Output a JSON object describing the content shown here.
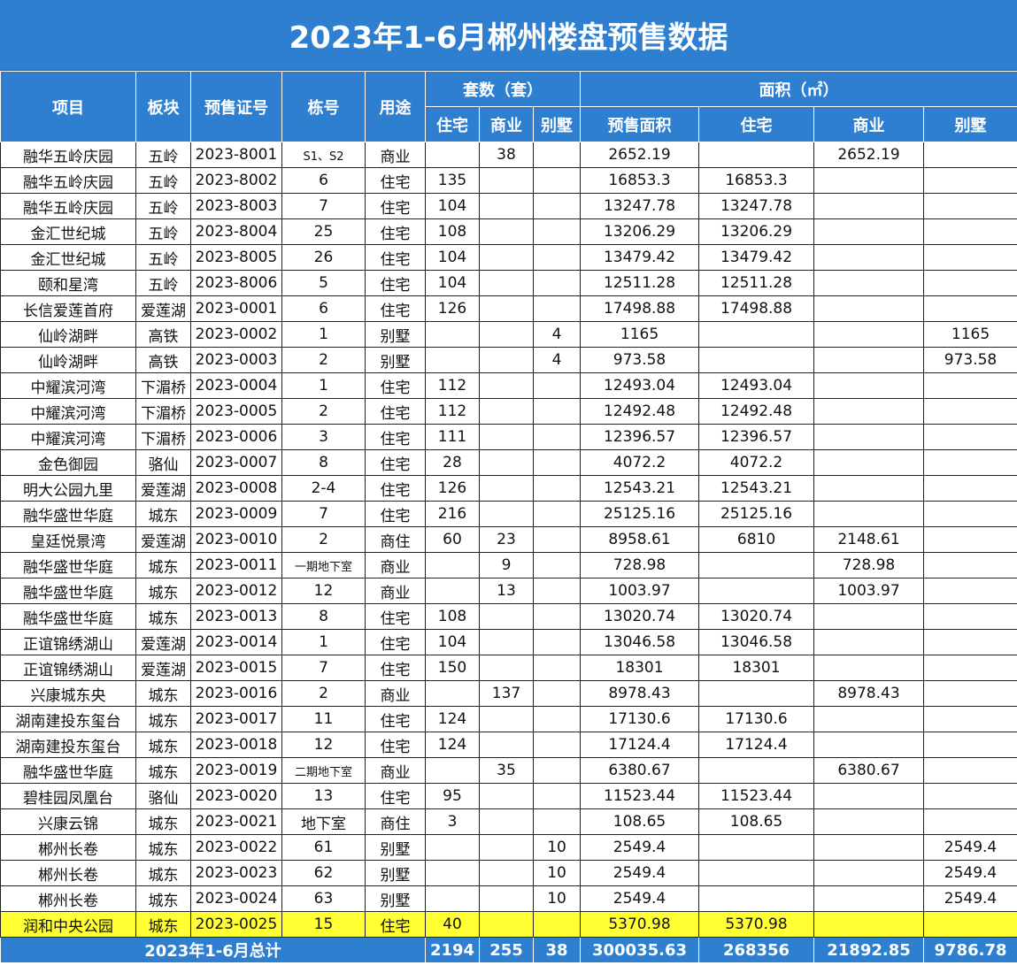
{
  "title": "2023年1-6月郴州楼盘预售数据",
  "headers": {
    "project": "项目",
    "block": "板块",
    "permit": "预售证号",
    "building": "栋号",
    "usage": "用途",
    "units_group": "套数（套）",
    "area_group": "面积（㎡）",
    "units_res": "住宅",
    "units_com": "商业",
    "units_villa": "别墅",
    "area_presale": "预售面积",
    "area_res": "住宅",
    "area_com": "商业",
    "area_villa": "别墅"
  },
  "rows": [
    {
      "project": "融华五岭庆园",
      "block": "五岭",
      "permit": "2023-8001",
      "building": "S1、S2",
      "usage": "商业",
      "u_res": "",
      "u_com": "38",
      "u_villa": "",
      "a_total": "2652.19",
      "a_res": "",
      "a_com": "2652.19",
      "a_villa": ""
    },
    {
      "project": "融华五岭庆园",
      "block": "五岭",
      "permit": "2023-8002",
      "building": "6",
      "usage": "住宅",
      "u_res": "135",
      "u_com": "",
      "u_villa": "",
      "a_total": "16853.3",
      "a_res": "16853.3",
      "a_com": "",
      "a_villa": ""
    },
    {
      "project": "融华五岭庆园",
      "block": "五岭",
      "permit": "2023-8003",
      "building": "7",
      "usage": "住宅",
      "u_res": "104",
      "u_com": "",
      "u_villa": "",
      "a_total": "13247.78",
      "a_res": "13247.78",
      "a_com": "",
      "a_villa": ""
    },
    {
      "project": "金汇世纪城",
      "block": "五岭",
      "permit": "2023-8004",
      "building": "25",
      "usage": "住宅",
      "u_res": "108",
      "u_com": "",
      "u_villa": "",
      "a_total": "13206.29",
      "a_res": "13206.29",
      "a_com": "",
      "a_villa": ""
    },
    {
      "project": "金汇世纪城",
      "block": "五岭",
      "permit": "2023-8005",
      "building": "26",
      "usage": "住宅",
      "u_res": "104",
      "u_com": "",
      "u_villa": "",
      "a_total": "13479.42",
      "a_res": "13479.42",
      "a_com": "",
      "a_villa": ""
    },
    {
      "project": "颐和星湾",
      "block": "五岭",
      "permit": "2023-8006",
      "building": "5",
      "usage": "住宅",
      "u_res": "104",
      "u_com": "",
      "u_villa": "",
      "a_total": "12511.28",
      "a_res": "12511.28",
      "a_com": "",
      "a_villa": ""
    },
    {
      "project": "长信爱莲首府",
      "block": "爱莲湖",
      "permit": "2023-0001",
      "building": "6",
      "usage": "住宅",
      "u_res": "126",
      "u_com": "",
      "u_villa": "",
      "a_total": "17498.88",
      "a_res": "17498.88",
      "a_com": "",
      "a_villa": ""
    },
    {
      "project": "仙岭湖畔",
      "block": "高铁",
      "permit": "2023-0002",
      "building": "1",
      "usage": "别墅",
      "u_res": "",
      "u_com": "",
      "u_villa": "4",
      "a_total": "1165",
      "a_res": "",
      "a_com": "",
      "a_villa": "1165"
    },
    {
      "project": "仙岭湖畔",
      "block": "高铁",
      "permit": "2023-0003",
      "building": "2",
      "usage": "别墅",
      "u_res": "",
      "u_com": "",
      "u_villa": "4",
      "a_total": "973.58",
      "a_res": "",
      "a_com": "",
      "a_villa": "973.58"
    },
    {
      "project": "中耀滨河湾",
      "block": "下湄桥",
      "permit": "2023-0004",
      "building": "1",
      "usage": "住宅",
      "u_res": "112",
      "u_com": "",
      "u_villa": "",
      "a_total": "12493.04",
      "a_res": "12493.04",
      "a_com": "",
      "a_villa": ""
    },
    {
      "project": "中耀滨河湾",
      "block": "下湄桥",
      "permit": "2023-0005",
      "building": "2",
      "usage": "住宅",
      "u_res": "112",
      "u_com": "",
      "u_villa": "",
      "a_total": "12492.48",
      "a_res": "12492.48",
      "a_com": "",
      "a_villa": ""
    },
    {
      "project": "中耀滨河湾",
      "block": "下湄桥",
      "permit": "2023-0006",
      "building": "3",
      "usage": "住宅",
      "u_res": "111",
      "u_com": "",
      "u_villa": "",
      "a_total": "12396.57",
      "a_res": "12396.57",
      "a_com": "",
      "a_villa": ""
    },
    {
      "project": "金色御园",
      "block": "骆仙",
      "permit": "2023-0007",
      "building": "8",
      "usage": "住宅",
      "u_res": "28",
      "u_com": "",
      "u_villa": "",
      "a_total": "4072.2",
      "a_res": "4072.2",
      "a_com": "",
      "a_villa": ""
    },
    {
      "project": "明大公园九里",
      "block": "爱莲湖",
      "permit": "2023-0008",
      "building": "2-4",
      "usage": "住宅",
      "u_res": "126",
      "u_com": "",
      "u_villa": "",
      "a_total": "12543.21",
      "a_res": "12543.21",
      "a_com": "",
      "a_villa": ""
    },
    {
      "project": "融华盛世华庭",
      "block": "城东",
      "permit": "2023-0009",
      "building": "7",
      "usage": "住宅",
      "u_res": "216",
      "u_com": "",
      "u_villa": "",
      "a_total": "25125.16",
      "a_res": "25125.16",
      "a_com": "",
      "a_villa": ""
    },
    {
      "project": "皇廷悦景湾",
      "block": "爱莲湖",
      "permit": "2023-0010",
      "building": "2",
      "usage": "商住",
      "u_res": "60",
      "u_com": "23",
      "u_villa": "",
      "a_total": "8958.61",
      "a_res": "6810",
      "a_com": "2148.61",
      "a_villa": ""
    },
    {
      "project": "融华盛世华庭",
      "block": "城东",
      "permit": "2023-0011",
      "building": "一期地下室",
      "usage": "商业",
      "u_res": "",
      "u_com": "9",
      "u_villa": "",
      "a_total": "728.98",
      "a_res": "",
      "a_com": "728.98",
      "a_villa": ""
    },
    {
      "project": "融华盛世华庭",
      "block": "城东",
      "permit": "2023-0012",
      "building": "12",
      "usage": "商业",
      "u_res": "",
      "u_com": "13",
      "u_villa": "",
      "a_total": "1003.97",
      "a_res": "",
      "a_com": "1003.97",
      "a_villa": ""
    },
    {
      "project": "融华盛世华庭",
      "block": "城东",
      "permit": "2023-0013",
      "building": "8",
      "usage": "住宅",
      "u_res": "108",
      "u_com": "",
      "u_villa": "",
      "a_total": "13020.74",
      "a_res": "13020.74",
      "a_com": "",
      "a_villa": ""
    },
    {
      "project": "正谊锦绣湖山",
      "block": "爱莲湖",
      "permit": "2023-0014",
      "building": "1",
      "usage": "住宅",
      "u_res": "104",
      "u_com": "",
      "u_villa": "",
      "a_total": "13046.58",
      "a_res": "13046.58",
      "a_com": "",
      "a_villa": ""
    },
    {
      "project": "正谊锦绣湖山",
      "block": "爱莲湖",
      "permit": "2023-0015",
      "building": "7",
      "usage": "住宅",
      "u_res": "150",
      "u_com": "",
      "u_villa": "",
      "a_total": "18301",
      "a_res": "18301",
      "a_com": "",
      "a_villa": ""
    },
    {
      "project": "兴康城东央",
      "block": "城东",
      "permit": "2023-0016",
      "building": "2",
      "usage": "商业",
      "u_res": "",
      "u_com": "137",
      "u_villa": "",
      "a_total": "8978.43",
      "a_res": "",
      "a_com": "8978.43",
      "a_villa": ""
    },
    {
      "project": "湖南建投东玺台",
      "block": "城东",
      "permit": "2023-0017",
      "building": "11",
      "usage": "住宅",
      "u_res": "124",
      "u_com": "",
      "u_villa": "",
      "a_total": "17130.6",
      "a_res": "17130.6",
      "a_com": "",
      "a_villa": ""
    },
    {
      "project": "湖南建投东玺台",
      "block": "城东",
      "permit": "2023-0018",
      "building": "12",
      "usage": "住宅",
      "u_res": "124",
      "u_com": "",
      "u_villa": "",
      "a_total": "17124.4",
      "a_res": "17124.4",
      "a_com": "",
      "a_villa": ""
    },
    {
      "project": "融华盛世华庭",
      "block": "城东",
      "permit": "2023-0019",
      "building": "二期地下室",
      "usage": "商业",
      "u_res": "",
      "u_com": "35",
      "u_villa": "",
      "a_total": "6380.67",
      "a_res": "",
      "a_com": "6380.67",
      "a_villa": ""
    },
    {
      "project": "碧桂园凤凰台",
      "block": "骆仙",
      "permit": "2023-0020",
      "building": "13",
      "usage": "住宅",
      "u_res": "95",
      "u_com": "",
      "u_villa": "",
      "a_total": "11523.44",
      "a_res": "11523.44",
      "a_com": "",
      "a_villa": ""
    },
    {
      "project": "兴康云锦",
      "block": "城东",
      "permit": "2023-0021",
      "building": "地下室",
      "usage": "商住",
      "u_res": "3",
      "u_com": "",
      "u_villa": "",
      "a_total": "108.65",
      "a_res": "108.65",
      "a_com": "",
      "a_villa": ""
    },
    {
      "project": "郴州长卷",
      "block": "城东",
      "permit": "2023-0022",
      "building": "61",
      "usage": "别墅",
      "u_res": "",
      "u_com": "",
      "u_villa": "10",
      "a_total": "2549.4",
      "a_res": "",
      "a_com": "",
      "a_villa": "2549.4"
    },
    {
      "project": "郴州长卷",
      "block": "城东",
      "permit": "2023-0023",
      "building": "62",
      "usage": "别墅",
      "u_res": "",
      "u_com": "",
      "u_villa": "10",
      "a_total": "2549.4",
      "a_res": "",
      "a_com": "",
      "a_villa": "2549.4"
    },
    {
      "project": "郴州长卷",
      "block": "城东",
      "permit": "2023-0024",
      "building": "63",
      "usage": "别墅",
      "u_res": "",
      "u_com": "",
      "u_villa": "10",
      "a_total": "2549.4",
      "a_res": "",
      "a_com": "",
      "a_villa": "2549.4"
    },
    {
      "project": "润和中央公园",
      "block": "城东",
      "permit": "2023-0025",
      "building": "15",
      "usage": "住宅",
      "u_res": "40",
      "u_com": "",
      "u_villa": "",
      "a_total": "5370.98",
      "a_res": "5370.98",
      "a_com": "",
      "a_villa": "",
      "highlight": true
    }
  ],
  "total": {
    "label": "2023年1-6月总计",
    "u_res": "2194",
    "u_com": "255",
    "u_villa": "38",
    "a_total": "300035.63",
    "a_res": "268356",
    "a_com": "21892.85",
    "a_villa": "9786.78"
  },
  "colors": {
    "header_bg": "#2f7fd0",
    "highlight_row": "#ffff33"
  }
}
